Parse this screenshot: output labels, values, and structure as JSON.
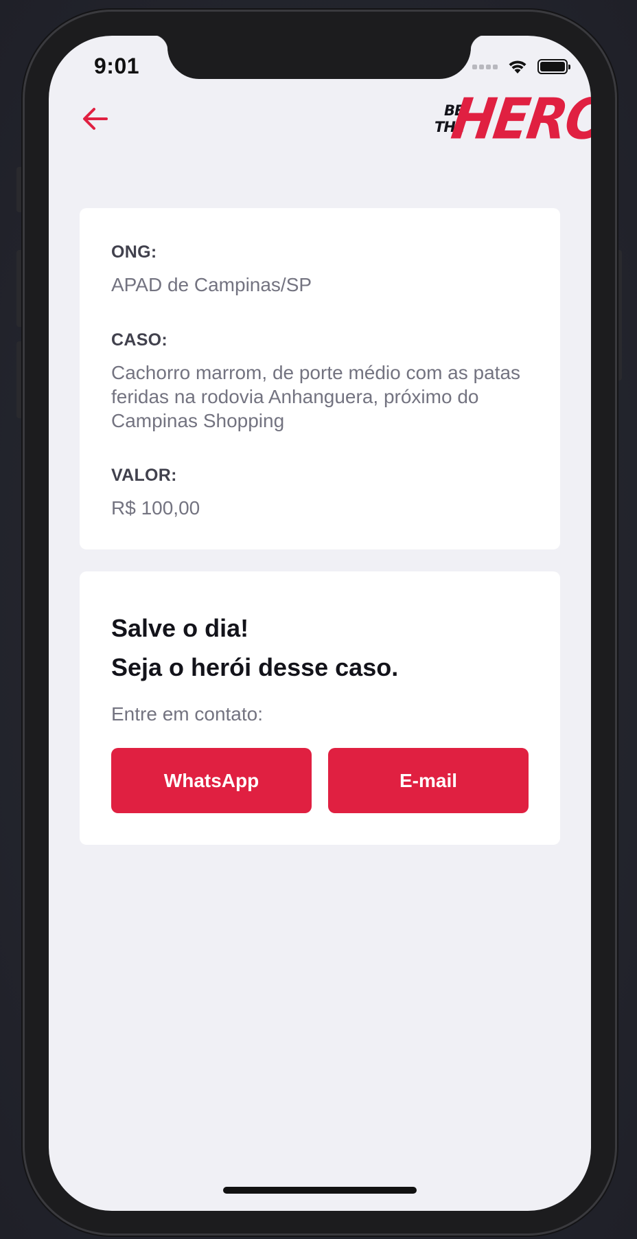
{
  "status_bar": {
    "time": "9:01",
    "icons": [
      "cellular-signal-icon",
      "wifi-icon",
      "battery-icon"
    ]
  },
  "header": {
    "back_icon": "arrow-left-icon",
    "logo": {
      "line1": "BE",
      "line2": "THE",
      "word": "HERO"
    }
  },
  "incident": {
    "ong_label": "ONG:",
    "ong_value": "APAD de Campinas/SP",
    "case_label": "CASO:",
    "case_value": "Cachorro marrom, de porte médio com as patas feridas na rodovia Anhanguera, próximo do Campinas Shopping",
    "value_label": "VALOR:",
    "value_value": "R$ 100,00"
  },
  "contact": {
    "title_line1": "Salve o dia!",
    "title_line2": "Seja o herói desse caso.",
    "description": "Entre em contato:",
    "whatsapp_label": "WhatsApp",
    "email_label": "E-mail"
  },
  "colors": {
    "brand": "#e02041",
    "background": "#f0f0f5",
    "card": "#ffffff",
    "label": "#41414d",
    "text": "#737380",
    "title": "#13131a"
  }
}
